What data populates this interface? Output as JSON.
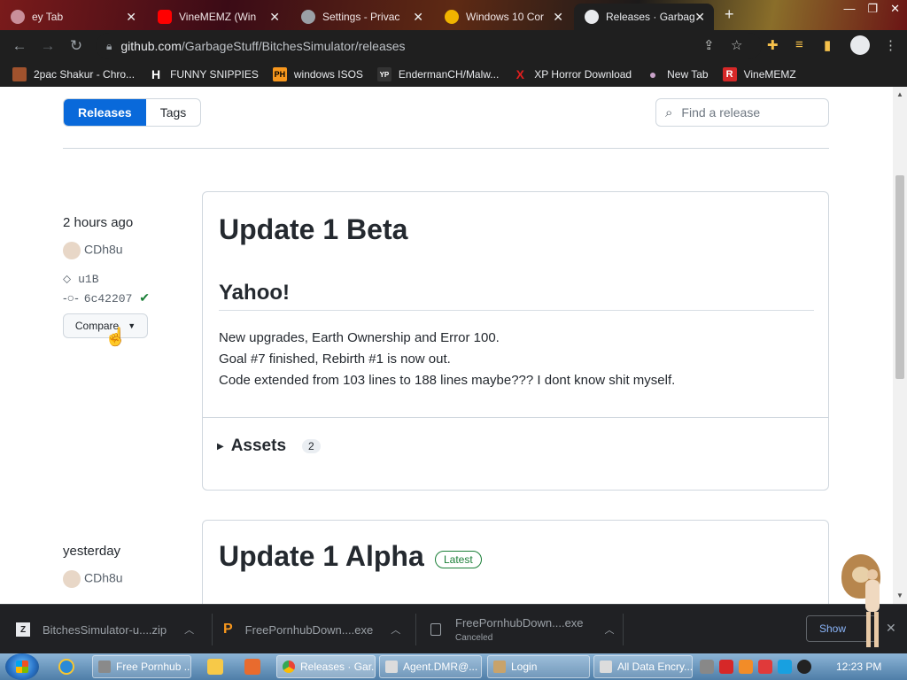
{
  "browser": {
    "tabs": [
      {
        "title": "ey Tab",
        "favicon_color": "#c98f9a"
      },
      {
        "title": "VineMEMZ (Win",
        "favicon_color": "#ff0000"
      },
      {
        "title": "Settings - Privac",
        "favicon_color": "#9aa0a6"
      },
      {
        "title": "Windows 10 Cor",
        "favicon_color": "#f0b400"
      },
      {
        "title": "Releases · Garbag",
        "favicon_color": "#e8eaed",
        "active": true
      }
    ],
    "new_tab_label": "+",
    "url_host": "github.com",
    "url_path": "/GarbageStuff/BitchesSimulator/releases",
    "bookmarks": [
      {
        "label": "2pac Shakur - Chro...",
        "icon": "person-photo-icon",
        "icon_color": "#a0522d",
        "glyph": "■"
      },
      {
        "label": "FUNNY SNIPPIES",
        "icon": "h-logo-icon",
        "icon_color": "#ffffff",
        "glyph": "H"
      },
      {
        "label": "windows ISOS",
        "icon": "ph-logo-icon",
        "icon_color": "#f7971d",
        "glyph": "PH"
      },
      {
        "label": "EndermanCH/Malw...",
        "icon": "yp-logo-icon",
        "icon_color": "#333333",
        "glyph": "YP"
      },
      {
        "label": "XP Horror Download",
        "icon": "x-logo-icon",
        "icon_color": "#e01e1e",
        "glyph": "X"
      },
      {
        "label": "New Tab",
        "icon": "globe-icon",
        "icon_color": "#c8a2c8",
        "glyph": "●"
      },
      {
        "label": "VineMEMZ",
        "icon": "r-logo-icon",
        "icon_color": "#d62828",
        "glyph": "R"
      }
    ]
  },
  "page": {
    "tab_releases": "Releases",
    "tab_tags": "Tags",
    "search_placeholder": "Find a release",
    "releases": [
      {
        "time": "2 hours ago",
        "author": "CDh8u",
        "tag": "u1B",
        "commit": "6c42207",
        "compare_label": "Compare",
        "title": "Update 1 Beta",
        "heading": "Yahoo!",
        "lines": [
          "New upgrades, Earth Ownership and Error 100.",
          "Goal #7 finished, Rebirth #1 is now out.",
          "Code extended from 103 lines to 188 lines maybe??? I dont know shit myself."
        ],
        "assets_label": "Assets",
        "assets_count": "2"
      },
      {
        "time": "yesterday",
        "author": "CDh8u",
        "title": "Update 1 Alpha",
        "badge": "Latest"
      }
    ]
  },
  "downloads": [
    {
      "name": "BitchesSimulator-u....zip",
      "status": ""
    },
    {
      "name": "FreePornhubDown....exe",
      "status": ""
    },
    {
      "name": "FreePornhubDown....exe",
      "status": "Canceled"
    }
  ],
  "show_all_label": "Show",
  "taskbar": {
    "buttons": [
      "Free Pornhub ...",
      "Releases · Gar...",
      "Agent.DMR@...",
      "Login",
      "All Data Encry..."
    ],
    "clock": "12:23 PM"
  },
  "colors": {
    "accent": "#0969da",
    "latest_green": "#1a7f37"
  }
}
